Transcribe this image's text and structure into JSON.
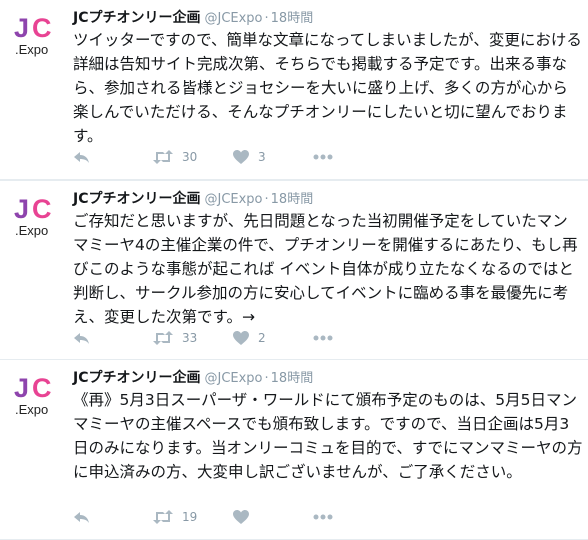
{
  "colors": {
    "accent_purple": "#8e44ad",
    "accent_magenta": "#e84393",
    "muted": "#8899a6",
    "divider": "#e6ecf0"
  },
  "tweets": [
    {
      "name": "JCプチオンリー企画",
      "handle": "@JCExpo",
      "dot": "·",
      "time": "18時間",
      "avatar_text": ".Expo",
      "avatar_letters": "JC",
      "text": "ツイッターですので、簡単な文章になってしまいましたが、変更における詳細は告知サイト完成次第、そちらでも掲載する予定です。出来る事なら、参加される皆様とジョセシーを大いに盛り上げ、多くの方が心から楽しんでいただける、そんなプチオンリーにしたいと切に望んでおります。",
      "retweets": "30",
      "likes": "3",
      "icons": [
        "reply-icon",
        "retweet-icon",
        "heart-icon",
        "more-icon"
      ]
    },
    {
      "name": "JCプチオンリー企画",
      "handle": "@JCExpo",
      "dot": "·",
      "time": "18時間",
      "avatar_text": ".Expo",
      "avatar_letters": "JC",
      "text": "ご存知だと思いますが、先日問題となった当初開催予定をしていたマンマミーヤ4の主催企業の件で、プチオンリーを開催するにあたり、もし再びこのような事態が起これば イベント自体が成り立たなくなるのではと判断し、サークル参加の方に安心してイベントに臨める事を最優先に考え、変更した次第です。→",
      "retweets": "33",
      "likes": "2",
      "icons": [
        "reply-icon",
        "retweet-icon",
        "heart-icon",
        "more-icon"
      ]
    },
    {
      "name": "JCプチオンリー企画",
      "handle": "@JCExpo",
      "dot": "·",
      "time": "18時間",
      "avatar_text": ".Expo",
      "avatar_letters": "JC",
      "text": "《再》5月3日スーパーザ・ワールドにて頒布予定のものは、5月5日マンマミーヤの主催スペースでも頒布致します。ですので、当日企画は5月3日のみになります。当オンリーコミュを目的で、すでにマンマミーヤの方に申込済みの方、大変申し訳ございませんが、ご了承ください。",
      "retweets": "19",
      "likes": "",
      "icons": [
        "reply-icon",
        "retweet-icon",
        "heart-icon",
        "more-icon"
      ]
    }
  ]
}
